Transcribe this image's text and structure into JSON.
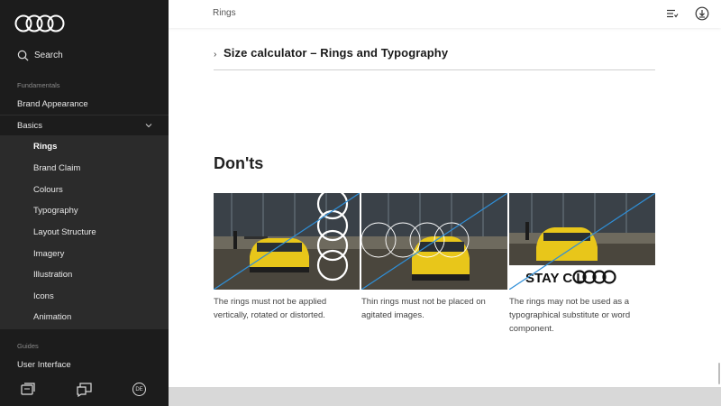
{
  "sidebar": {
    "search_label": "Search",
    "sections": {
      "fundamentals": "Fundamentals",
      "guides": "Guides"
    },
    "items": {
      "brand_appearance": "Brand Appearance",
      "basics": "Basics",
      "rings": "Rings",
      "brand_claim": "Brand Claim",
      "colours": "Colours",
      "typography": "Typography",
      "layout_structure": "Layout Structure",
      "imagery": "Imagery",
      "illustration": "Illustration",
      "icons": "Icons",
      "animation": "Animation",
      "user_interface": "User Interface"
    },
    "language_badge": "DE"
  },
  "header": {
    "breadcrumb": "Rings"
  },
  "main": {
    "accordion_title": "Size calculator – Rings and Typography",
    "section_title": "Don'ts",
    "cards": [
      {
        "caption": "The rings must not be applied vertically, rotated or distorted."
      },
      {
        "caption": "Thin rings must not be placed on agitated images."
      },
      {
        "caption": "The rings may not be used as a typographical substitute or word component.",
        "overlay_text": "STAY C   L"
      }
    ]
  },
  "colors": {
    "sidebar_bg": "#1c1c1c",
    "sidebar_sub_bg": "#2b2b2b",
    "accent_line": "#2f8fd8",
    "car_yellow": "#e8c61a"
  }
}
